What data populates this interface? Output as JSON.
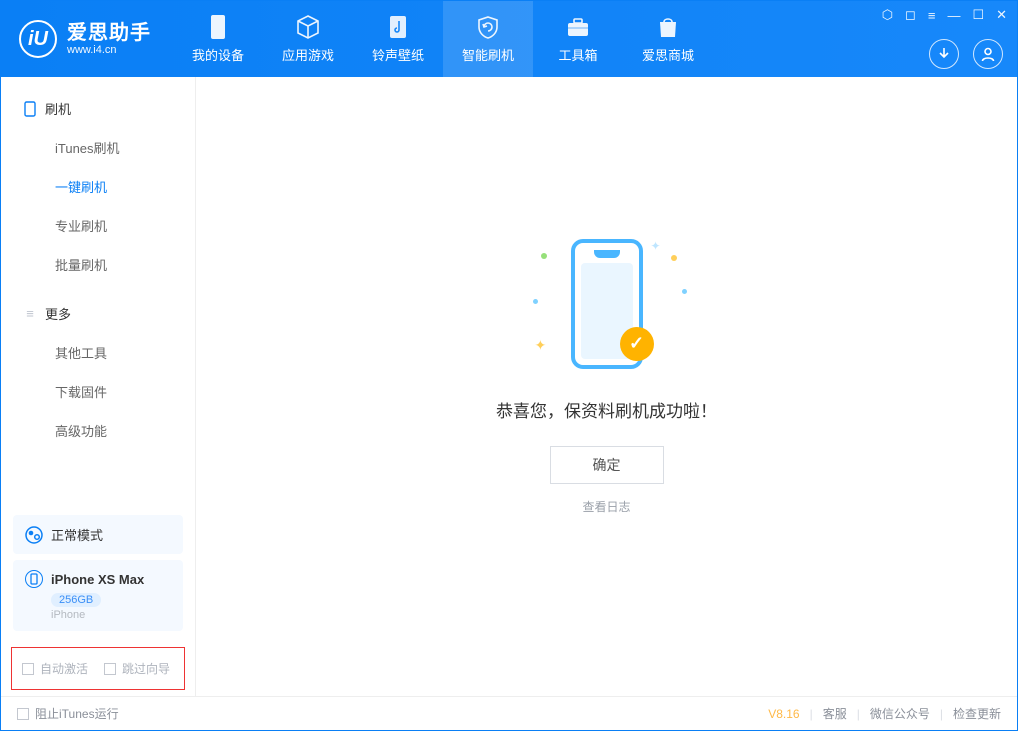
{
  "app": {
    "title": "爱思助手",
    "subtitle": "www.i4.cn"
  },
  "tabs": [
    {
      "label": "我的设备"
    },
    {
      "label": "应用游戏"
    },
    {
      "label": "铃声壁纸"
    },
    {
      "label": "智能刷机"
    },
    {
      "label": "工具箱"
    },
    {
      "label": "爱思商城"
    }
  ],
  "sidebar": {
    "group1": {
      "title": "刷机"
    },
    "items1": [
      {
        "label": "iTunes刷机"
      },
      {
        "label": "一键刷机"
      },
      {
        "label": "专业刷机"
      },
      {
        "label": "批量刷机"
      }
    ],
    "group2": {
      "title": "更多"
    },
    "items2": [
      {
        "label": "其他工具"
      },
      {
        "label": "下载固件"
      },
      {
        "label": "高级功能"
      }
    ]
  },
  "mode": {
    "label": "正常模式"
  },
  "device": {
    "name": "iPhone XS Max",
    "capacity": "256GB",
    "type": "iPhone"
  },
  "options": {
    "auto_activate": "自动激活",
    "skip_guide": "跳过向导"
  },
  "main": {
    "message": "恭喜您，保资料刷机成功啦！",
    "ok": "确定",
    "view_log": "查看日志"
  },
  "footer": {
    "block_itunes": "阻止iTunes运行",
    "version": "V8.16",
    "support": "客服",
    "wechat": "微信公众号",
    "update": "检查更新"
  }
}
